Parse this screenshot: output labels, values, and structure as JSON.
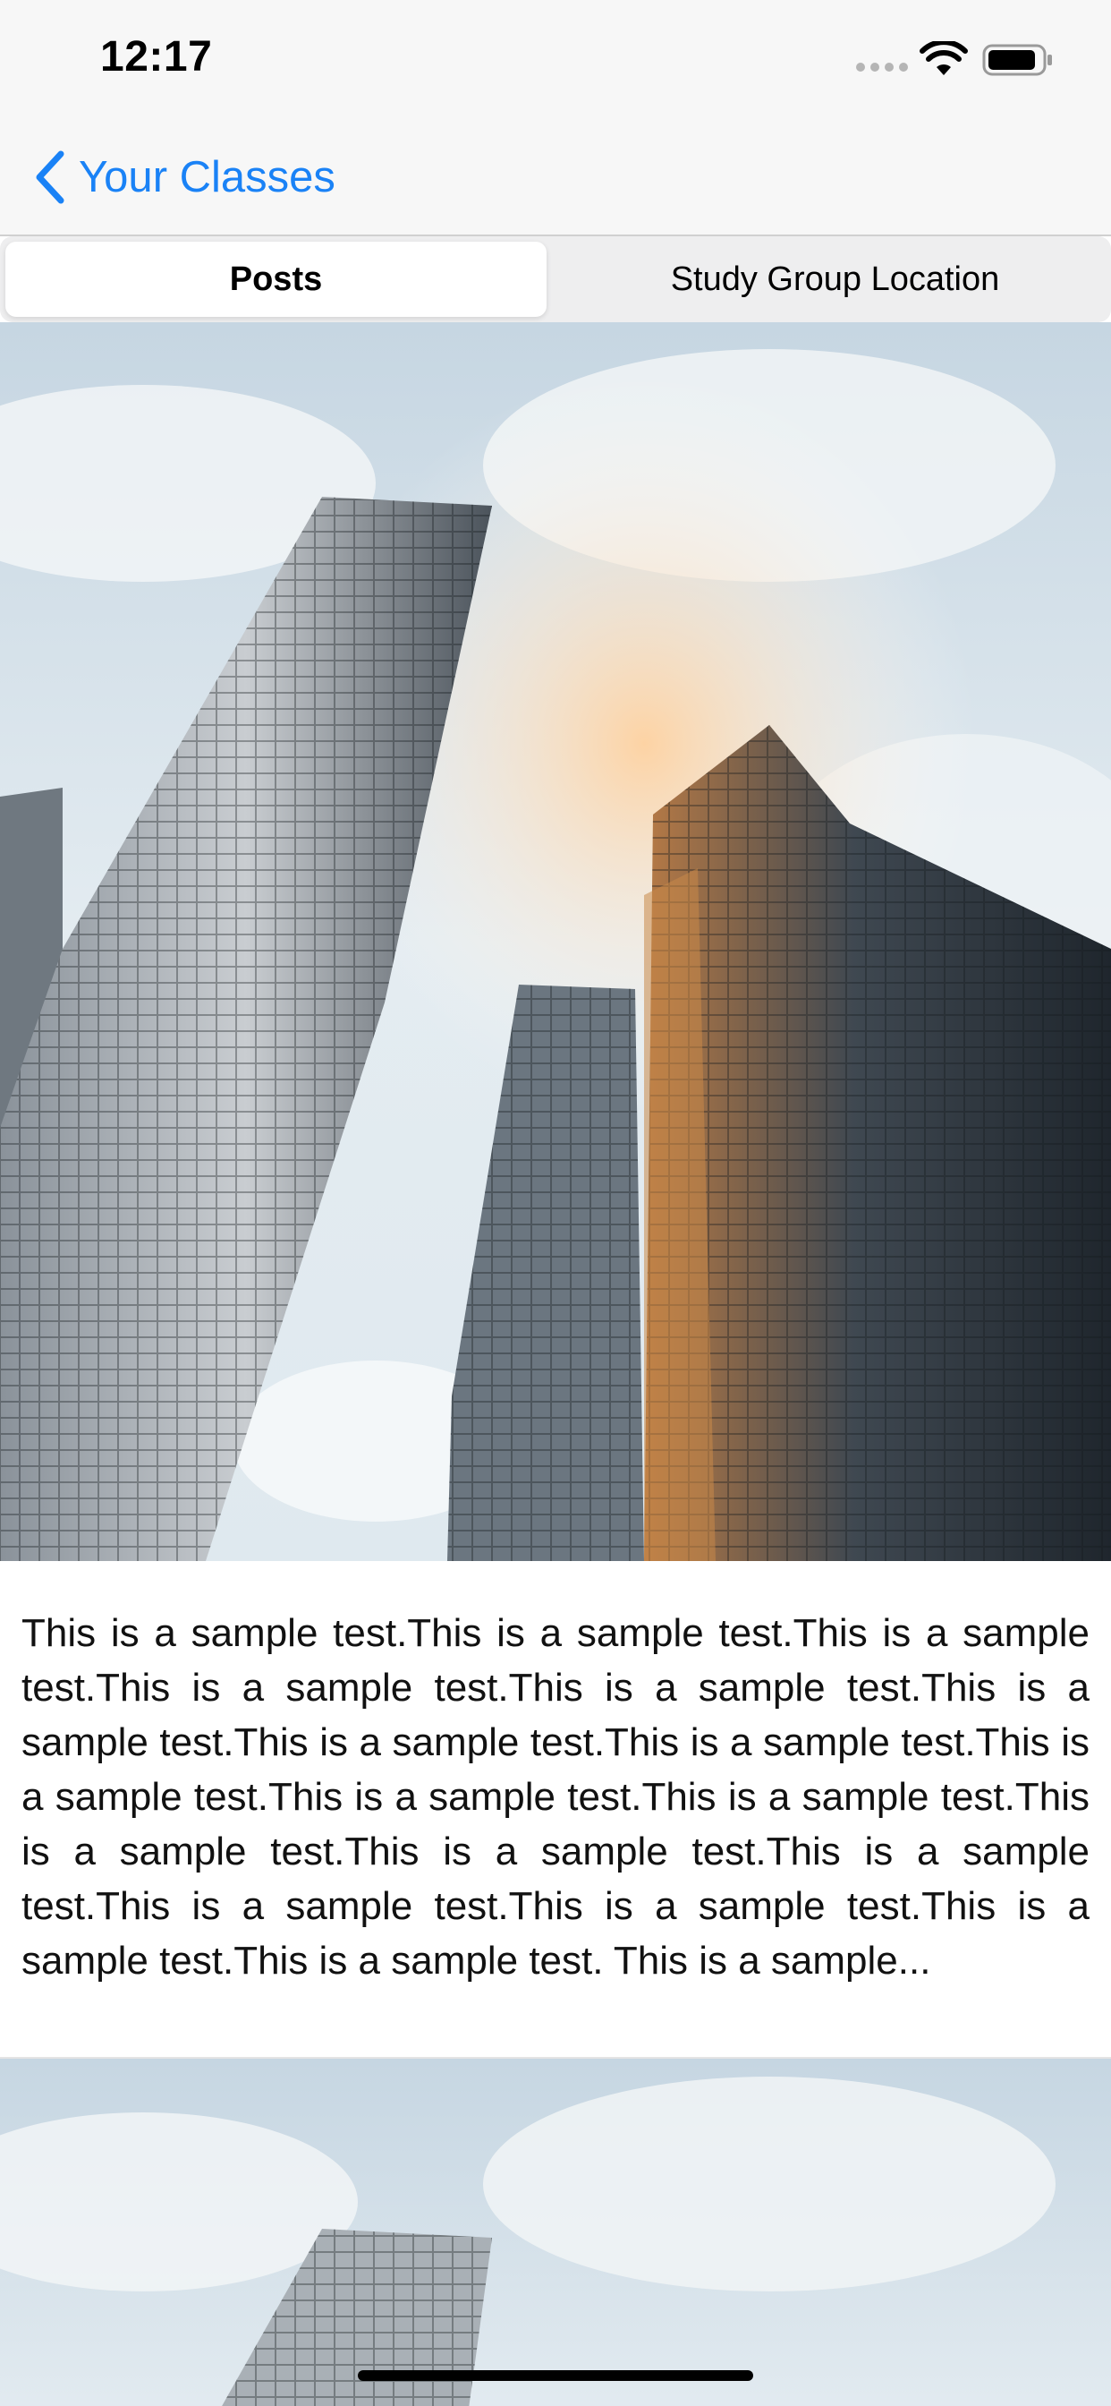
{
  "status_bar": {
    "time": "12:17"
  },
  "nav": {
    "back_label": "Your Classes"
  },
  "segments": [
    {
      "label": "Posts",
      "selected": true
    },
    {
      "label": "Study Group Location",
      "selected": false
    }
  ],
  "posts": [
    {
      "image": "skyscrapers-photo",
      "text": "This is a sample test.This is a sample test.This is a sample test.This is a sample test.This is a sample test.This is a sample test.This is a sample test.This is a sample test.This is a sample test.This is a sample test.This is a sample test.This is a sample test.This is a sample test.This is a sample test.This is a sample test.This is a sample test.This is a sample test.This is a sample test. This is a sample..."
    },
    {
      "image": "skyscrapers-photo"
    }
  ],
  "colors": {
    "accent": "#1a82f6",
    "bar_background": "#f7f7f7"
  }
}
